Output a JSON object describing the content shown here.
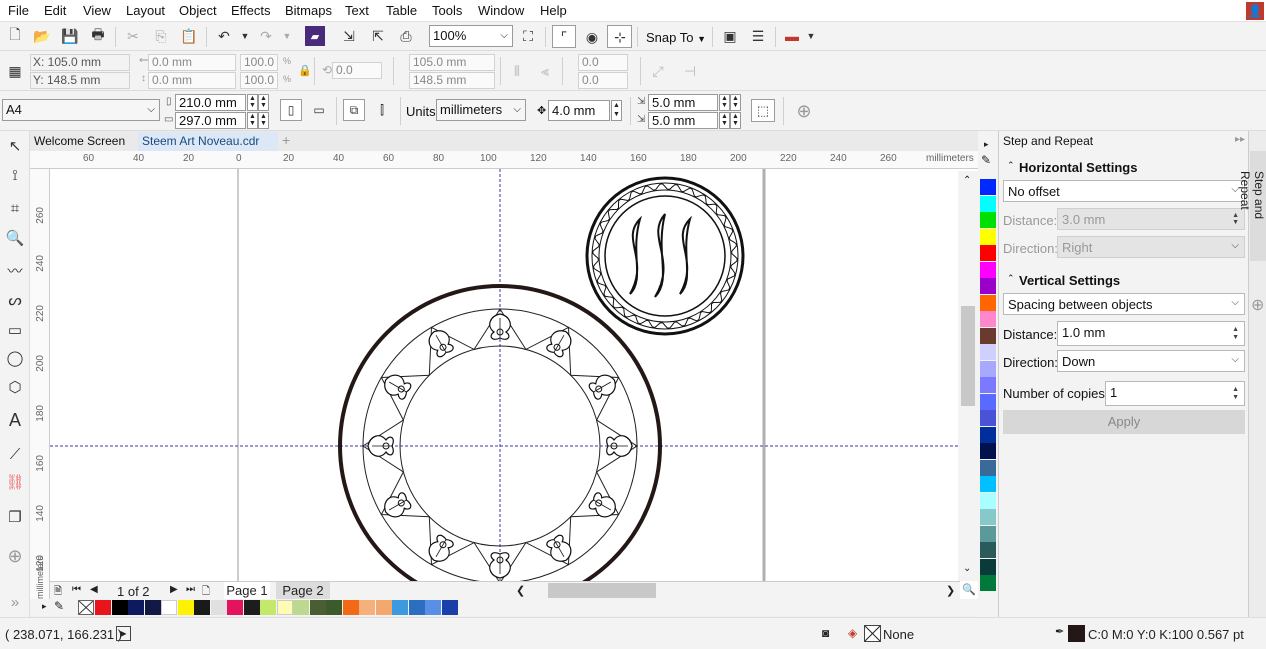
{
  "menu": [
    "File",
    "Edit",
    "View",
    "Layout",
    "Object",
    "Effects",
    "Bitmaps",
    "Text",
    "Table",
    "Tools",
    "Window",
    "Help"
  ],
  "std_toolbar": {
    "zoom": "100%",
    "snap_to": "Snap To"
  },
  "prop_bar": {
    "x": "X: 105.0 mm",
    "y": "Y: 148.5 mm",
    "width": "0.0 mm",
    "height": "0.0 mm",
    "scale_w": "100.0",
    "scale_h": "100.0",
    "pct1": "%",
    "pct2": "%",
    "angle": "0.0",
    "size_w": "105.0 mm",
    "size_h": "148.5 mm",
    "skew1": "0.0",
    "skew2": "0.0"
  },
  "page_bar": {
    "page_size": "A4",
    "page_width": "210.0 mm",
    "page_height": "297.0 mm",
    "units_label": "Units:",
    "units": "millimeters",
    "nudge": "4.0 mm",
    "dup_x": "5.0 mm",
    "dup_y": "5.0 mm"
  },
  "tabs": [
    "Welcome Screen",
    "Steem Art Noveau.cdr"
  ],
  "ruler": {
    "h_labels": [
      "60",
      "40",
      "20",
      "0",
      "20",
      "40",
      "60",
      "80",
      "100",
      "120",
      "140",
      "160",
      "180",
      "200",
      "220",
      "240",
      "260"
    ],
    "unit": "millimeters",
    "v_labels": [
      "260",
      "240",
      "220",
      "200",
      "180",
      "160",
      "140",
      "120"
    ],
    "v_unit": "millimeters"
  },
  "page_nav": {
    "count": "1 of 2",
    "pages": [
      "Page 1",
      "Page 2"
    ]
  },
  "colors": {
    "bottom": [
      "#e8161a",
      "#000000",
      "#0f1a5e",
      "#101a45",
      "#ffffff",
      "#fff200",
      "#1a1a1a",
      "#e0e0e0",
      "#e3135d",
      "#1d1d1d",
      "#c4e86a",
      "#fdfbb4",
      "#bcd98f",
      "#4a5e34",
      "#3d5a2b",
      "#f26a17",
      "#f6b07c",
      "#f3a86d",
      "#3d9adf",
      "#2c6fbe",
      "#5a8fe8",
      "#1a3fa8"
    ],
    "vertical": [
      "#0028ff",
      "#00ffff",
      "#00e000",
      "#ffff00",
      "#ff0000",
      "#ff00ff",
      "#9900cc",
      "#ff6600",
      "#ff88cc",
      "#6b3a2e",
      "#d0d0ff",
      "#a8a8ff",
      "#7a7aff",
      "#5a6aff",
      "#4a52d8",
      "#002e9a",
      "#00114d",
      "#3a6a9a",
      "#00c0ff",
      "#a8ffff",
      "#88c8c8",
      "#5a9a9a",
      "#2a5a5a",
      "#0a3a3a",
      "#007a3a"
    ]
  },
  "docker": {
    "title": "Step and Repeat",
    "side_tab": "Step and Repeat",
    "horizontal": {
      "title": "Horizontal Settings",
      "mode": "No offset",
      "distance_label": "Distance:",
      "distance": "3.0 mm",
      "direction_label": "Direction:",
      "direction": "Right"
    },
    "vertical": {
      "title": "Vertical Settings",
      "mode": "Spacing between objects",
      "distance_label": "Distance:",
      "distance": "1.0 mm",
      "direction_label": "Direction:",
      "direction": "Down"
    },
    "copies_label": "Number of copies:",
    "copies": "1",
    "apply": "Apply"
  },
  "status": {
    "coords": "( 238.071, 166.231 )",
    "fill": "None",
    "outline": "C:0 M:0 Y:0 K:100  0.567 pt"
  }
}
